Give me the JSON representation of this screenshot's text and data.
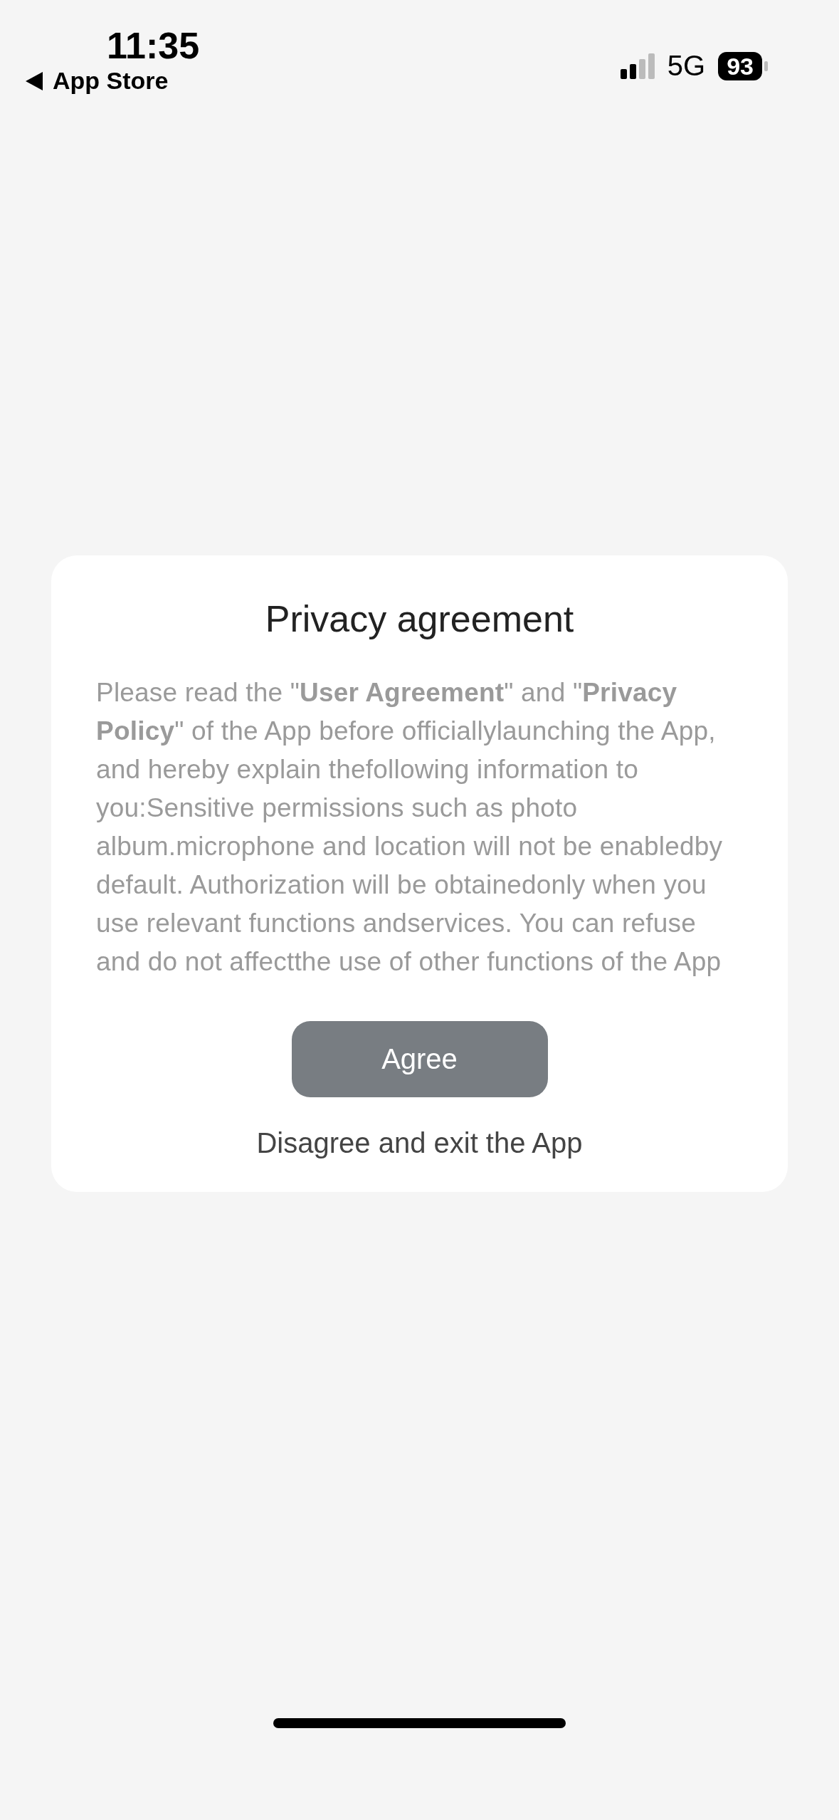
{
  "status_bar": {
    "time": "11:35",
    "back_label": "App Store",
    "network": "5G",
    "battery": "93"
  },
  "dialog": {
    "title": "Privacy agreement",
    "body": "Please read the \"**User Agreement**\" and \"**Privacy Policy**\" of the App before officiallylaunching the App, and hereby explain thefollowing information to you:Sensitive permissions such as photo album.microphone and location will not be enabledby default. Authorization will be obtainedonly when you use relevant functions andservices. You can refuse and do not affectthe use of other functions of the App",
    "agree_button": "Agree",
    "disagree_link": "Disagree and exit the App"
  }
}
